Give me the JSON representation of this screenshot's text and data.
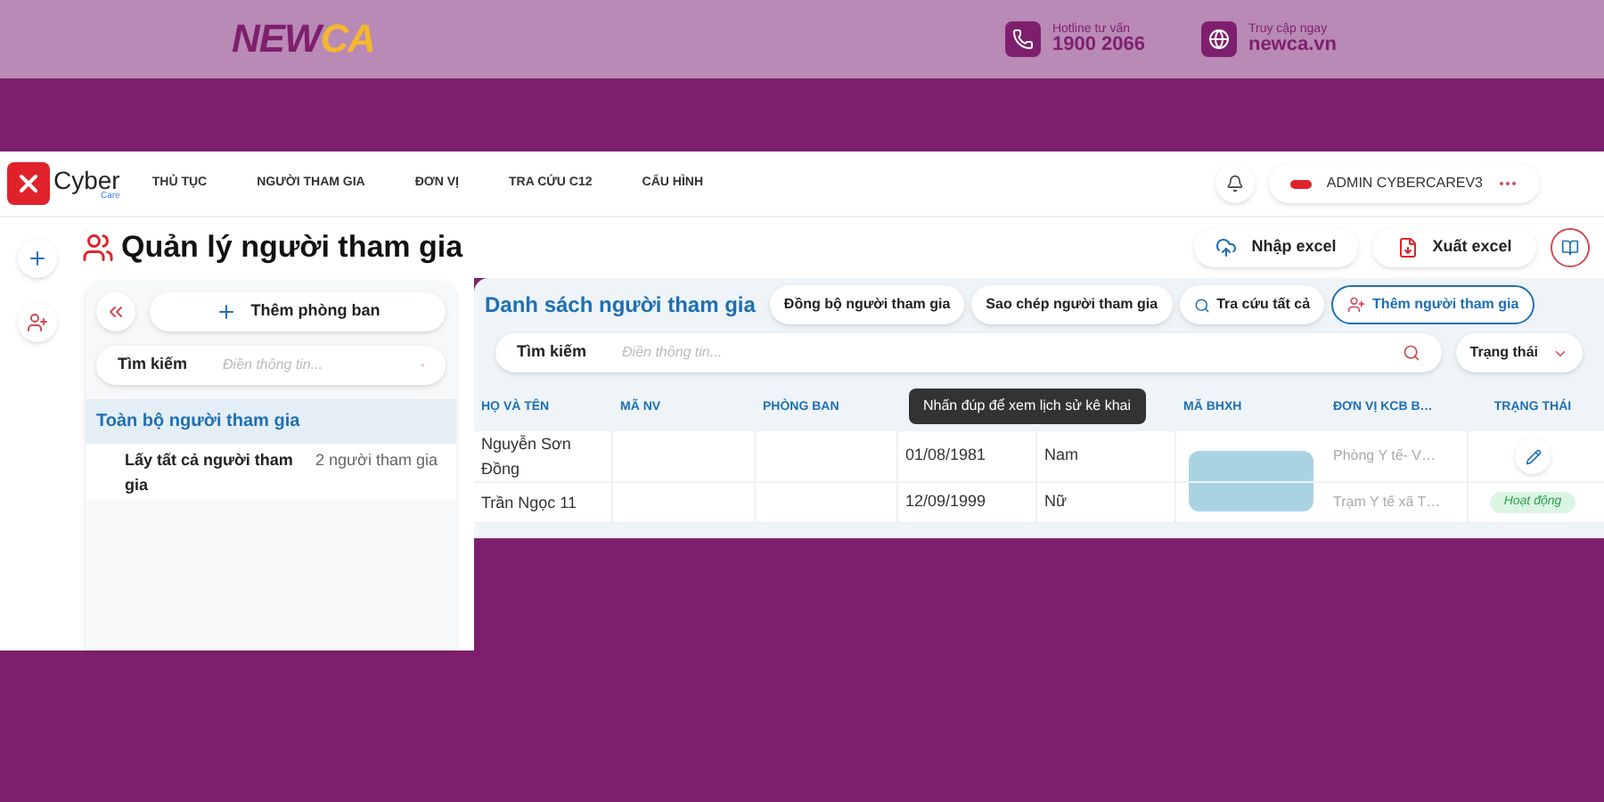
{
  "banner": {
    "logo": [
      "NEW",
      "CA"
    ],
    "contacts": [
      {
        "kind": "phone",
        "label": "Hotline tư vấn",
        "value": "1900 2066"
      },
      {
        "kind": "web",
        "label": "Truy cập ngay",
        "value": "newca.vn"
      }
    ]
  },
  "app": {
    "logo": {
      "name": "Cyber",
      "sub": "Care"
    },
    "nav": [
      "THỦ TỤC",
      "NGƯỜI THAM GIA",
      "ĐƠN VỊ",
      "TRA CỨU C12",
      "CẤU HÌNH"
    ],
    "user": "ADMIN CYBERCAREV3"
  },
  "page": {
    "title": "Quản lý người tham gia",
    "actions": [
      {
        "kind": "import",
        "label": "Nhập excel"
      },
      {
        "kind": "export",
        "label": "Xuất excel"
      }
    ]
  },
  "left_panel": {
    "add_button": "Thêm phòng ban",
    "search": {
      "label": "Tìm kiếm",
      "placeholder": "Điền thông tin..."
    },
    "tree": [
      {
        "label": "Toàn bộ người tham gia",
        "selected": true,
        "children": [
          {
            "label": "Lấy tất cả người tham gia",
            "count": "2 người tham gia",
            "selected": false
          }
        ]
      }
    ]
  },
  "list": {
    "title": "Danh sách người tham gia",
    "actions": [
      {
        "kind": "plain",
        "label": "Đồng bộ người tham gia"
      },
      {
        "kind": "plain",
        "label": "Sao chép người tham gia"
      },
      {
        "kind": "search",
        "label": "Tra cứu tất cả"
      },
      {
        "kind": "add",
        "label": "Thêm người tham gia"
      }
    ],
    "search": {
      "label": "Tìm kiếm",
      "placeholder": "Điền thông tin..."
    },
    "status_filter": "Trạng thái",
    "columns": [
      "HỌ VÀ TÊN",
      "MÃ NV",
      "PHÒNG BAN",
      "MÃ BHXH",
      "ĐƠN VỊ KCB B…",
      "TRẠNG THÁI"
    ],
    "tooltip": "Nhấn đúp để xem lịch sử kê khai",
    "rows": [
      {
        "ho_va_ten": "Nguyễn Sơn Đồng",
        "column_4": "01/08/1981",
        "column_5": "Nam",
        "ma_bhxh_redacted": true,
        "don_vi_kcb": "Phòng Y tế- V…",
        "status": {
          "kind": "edit"
        }
      },
      {
        "ho_va_ten": "Trần Ngọc 11",
        "column_4": "12/09/1999",
        "column_5": "Nữ",
        "ma_bhxh_redacted": true,
        "don_vi_kcb": "Trạm Y tế xã T…",
        "status": {
          "kind": "badge",
          "label": "Hoạt động"
        }
      }
    ]
  }
}
